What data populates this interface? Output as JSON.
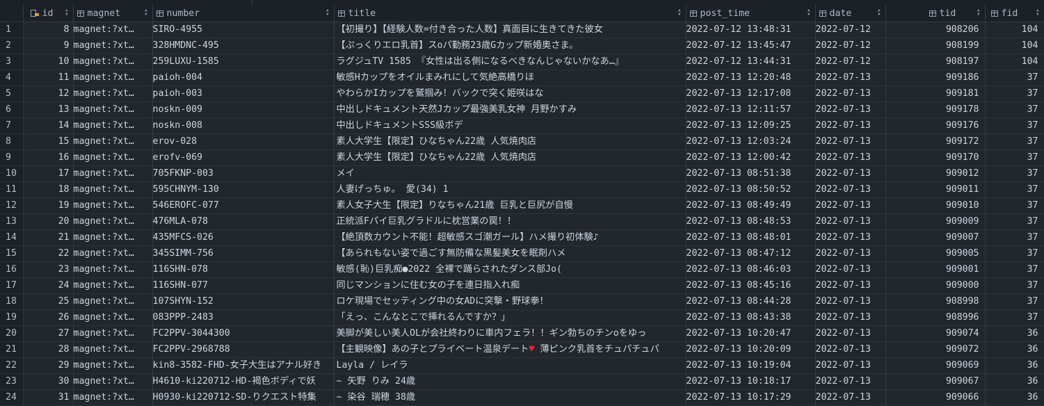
{
  "columns": [
    {
      "key": "id",
      "label": "id",
      "icon": "primary-key-icon",
      "align": "right"
    },
    {
      "key": "magnet",
      "label": "magnet",
      "icon": "table-column-icon",
      "align": "left"
    },
    {
      "key": "number",
      "label": "number",
      "icon": "table-column-icon",
      "align": "left"
    },
    {
      "key": "title",
      "label": "title",
      "icon": "table-column-icon",
      "align": "left"
    },
    {
      "key": "post_time",
      "label": "post_time",
      "icon": "table-column-icon",
      "align": "left"
    },
    {
      "key": "date",
      "label": "date",
      "icon": "table-column-icon",
      "align": "left"
    },
    {
      "key": "tid",
      "label": "tid",
      "icon": "table-column-icon",
      "align": "right"
    },
    {
      "key": "fid",
      "label": "fid",
      "icon": "table-column-icon",
      "align": "right"
    }
  ],
  "rows": [
    {
      "rn": "1",
      "id": "8",
      "magnet": "magnet:?xt…",
      "number": "SIRO-4955",
      "title": "【初撮り】【経験人数=付き合った人数】真面目に生きてきた彼女",
      "post_time": "2022-07-12 13:48:31",
      "date": "2022-07-12",
      "tid": "908206",
      "fid": "104"
    },
    {
      "rn": "2",
      "id": "9",
      "magnet": "magnet:?xt…",
      "number": "328HMDNC-495",
      "title": "【ぷっくりエロ乳首】スoパ勤務23歳Gカップ新婚奥さま。",
      "post_time": "2022-07-12 13:45:47",
      "date": "2022-07-12",
      "tid": "908199",
      "fid": "104"
    },
    {
      "rn": "3",
      "id": "10",
      "magnet": "magnet:?xt…",
      "number": "259LUXU-1585",
      "title": "ラグジュTV 1585 『女性は出る側になるべきなんじゃないかなあ…』",
      "post_time": "2022-07-12 13:44:31",
      "date": "2022-07-12",
      "tid": "908197",
      "fid": "104"
    },
    {
      "rn": "4",
      "id": "11",
      "magnet": "magnet:?xt…",
      "number": "paioh-004",
      "title": "敏感Hカップをオイルまみれにして気絶高橋りほ",
      "post_time": "2022-07-13 12:20:48",
      "date": "2022-07-13",
      "tid": "909186",
      "fid": "37"
    },
    {
      "rn": "5",
      "id": "12",
      "magnet": "magnet:?xt…",
      "number": "paioh-003",
      "title": "やわらかIカップを鷲掴み！バックで突く姫咲はな",
      "post_time": "2022-07-13 12:17:08",
      "date": "2022-07-13",
      "tid": "909181",
      "fid": "37"
    },
    {
      "rn": "6",
      "id": "13",
      "magnet": "magnet:?xt…",
      "number": "noskn-009",
      "title": "中出しドキュメント天然Jカップ最強美乳女神 月野かすみ",
      "post_time": "2022-07-13 12:11:57",
      "date": "2022-07-13",
      "tid": "909178",
      "fid": "37"
    },
    {
      "rn": "7",
      "id": "14",
      "magnet": "magnet:?xt…",
      "number": "noskn-008",
      "title": "中出しドキュメントSSS級ボデ",
      "post_time": "2022-07-13 12:09:25",
      "date": "2022-07-13",
      "tid": "909176",
      "fid": "37"
    },
    {
      "rn": "8",
      "id": "15",
      "magnet": "magnet:?xt…",
      "number": "erov-028",
      "title": "素人大学生【限定】ひなちゃん22歳 人気焼肉店",
      "post_time": "2022-07-13 12:03:24",
      "date": "2022-07-13",
      "tid": "909172",
      "fid": "37"
    },
    {
      "rn": "9",
      "id": "16",
      "magnet": "magnet:?xt…",
      "number": "erofv-069",
      "title": "素人大学生【限定】ひなちゃん22歳 人気焼肉店",
      "post_time": "2022-07-13 12:00:42",
      "date": "2022-07-13",
      "tid": "909170",
      "fid": "37"
    },
    {
      "rn": "10",
      "id": "17",
      "magnet": "magnet:?xt…",
      "number": "705FKNP-003",
      "title": "メイ",
      "post_time": "2022-07-13 08:51:38",
      "date": "2022-07-13",
      "tid": "909012",
      "fid": "37"
    },
    {
      "rn": "11",
      "id": "18",
      "magnet": "magnet:?xt…",
      "number": "595CHNYM-130",
      "title": "人妻げっちゅ。 愛(34) 1",
      "post_time": "2022-07-13 08:50:52",
      "date": "2022-07-13",
      "tid": "909011",
      "fid": "37"
    },
    {
      "rn": "12",
      "id": "19",
      "magnet": "magnet:?xt…",
      "number": "546EROFC-077",
      "title": "素人女子大生【限定】りなちゃん21歳 巨乳と巨尻が自慢",
      "post_time": "2022-07-13 08:49:49",
      "date": "2022-07-13",
      "tid": "909010",
      "fid": "37"
    },
    {
      "rn": "13",
      "id": "20",
      "magnet": "magnet:?xt…",
      "number": "476MLA-078",
      "title": "正統派Fパイ巨乳グラドルに枕営業の罠！！",
      "post_time": "2022-07-13 08:48:53",
      "date": "2022-07-13",
      "tid": "909009",
      "fid": "37"
    },
    {
      "rn": "14",
      "id": "21",
      "magnet": "magnet:?xt…",
      "number": "435MFCS-026",
      "title": "【絶頂数カウント不能！超敏感スゴ潮ガール】ハメ撮り初体験♪",
      "post_time": "2022-07-13 08:48:01",
      "date": "2022-07-13",
      "tid": "909007",
      "fid": "37"
    },
    {
      "rn": "15",
      "id": "22",
      "magnet": "magnet:?xt…",
      "number": "345SIMM-756",
      "title": "【あられもない姿で過ごす無防備な黒髪美女を眠剤ハメ",
      "post_time": "2022-07-13 08:47:12",
      "date": "2022-07-13",
      "tid": "909005",
      "fid": "37"
    },
    {
      "rn": "16",
      "id": "23",
      "magnet": "magnet:?xt…",
      "number": "116SHN-078",
      "title": "敏感(恥)巨乳痴●2022 全裸で踊らされたダンス部Jo(",
      "post_time": "2022-07-13 08:46:03",
      "date": "2022-07-13",
      "tid": "909001",
      "fid": "37"
    },
    {
      "rn": "17",
      "id": "24",
      "magnet": "magnet:?xt…",
      "number": "116SHN-077",
      "title": "同じマンションに住む女の子を連日指入れ痴",
      "post_time": "2022-07-13 08:45:16",
      "date": "2022-07-13",
      "tid": "909000",
      "fid": "37"
    },
    {
      "rn": "18",
      "id": "25",
      "magnet": "magnet:?xt…",
      "number": "107SHYN-152",
      "title": "ロケ現場でセッティング中の女ADに突撃・野球拳！",
      "post_time": "2022-07-13 08:44:28",
      "date": "2022-07-13",
      "tid": "908998",
      "fid": "37"
    },
    {
      "rn": "19",
      "id": "26",
      "magnet": "magnet:?xt…",
      "number": "083PPP-2483",
      "title": "「えっ、こんなとこで挿れるんですか？」",
      "post_time": "2022-07-13 08:43:38",
      "date": "2022-07-13",
      "tid": "908996",
      "fid": "37"
    },
    {
      "rn": "20",
      "id": "27",
      "magnet": "magnet:?xt…",
      "number": "FC2PPV-3044300",
      "title": "美脚が美しい美人OLが会社終わりに車内フェラ！！ギン勃ちのチンoをゆっ",
      "post_time": "2022-07-13 10:20:47",
      "date": "2022-07-13",
      "tid": "909074",
      "fid": "36"
    },
    {
      "rn": "21",
      "id": "28",
      "magnet": "magnet:?xt…",
      "number": "FC2PPV-2968788",
      "title": "【主観映像】あの子とプライベート温泉デート",
      "title_heart": "♥",
      "title_tail": " 薄ピンク乳首をチュパチュパ",
      "post_time": "2022-07-13 10:20:09",
      "date": "2022-07-13",
      "tid": "909072",
      "fid": "36"
    },
    {
      "rn": "22",
      "id": "29",
      "magnet": "magnet:?xt…",
      "number": "kin8-3582-FHD-女子大生はアナル好き",
      "title": "Layla / レイラ",
      "post_time": "2022-07-13 10:19:04",
      "date": "2022-07-13",
      "tid": "909069",
      "fid": "36"
    },
    {
      "rn": "23",
      "id": "30",
      "magnet": "magnet:?xt…",
      "number": "H4610-ki220712-HD-褐色ボディで妖",
      "title": "~ 矢野 りみ 24歳",
      "post_time": "2022-07-13 10:18:17",
      "date": "2022-07-13",
      "tid": "909067",
      "fid": "36"
    },
    {
      "rn": "24",
      "id": "31",
      "magnet": "magnet:?xt…",
      "number": "H0930-ki220712-SD-りクエスト特集",
      "title": "~ 染谷 瑞穂 38歳",
      "post_time": "2022-07-13 10:17:29",
      "date": "2022-07-13",
      "tid": "909066",
      "fid": "36"
    }
  ]
}
